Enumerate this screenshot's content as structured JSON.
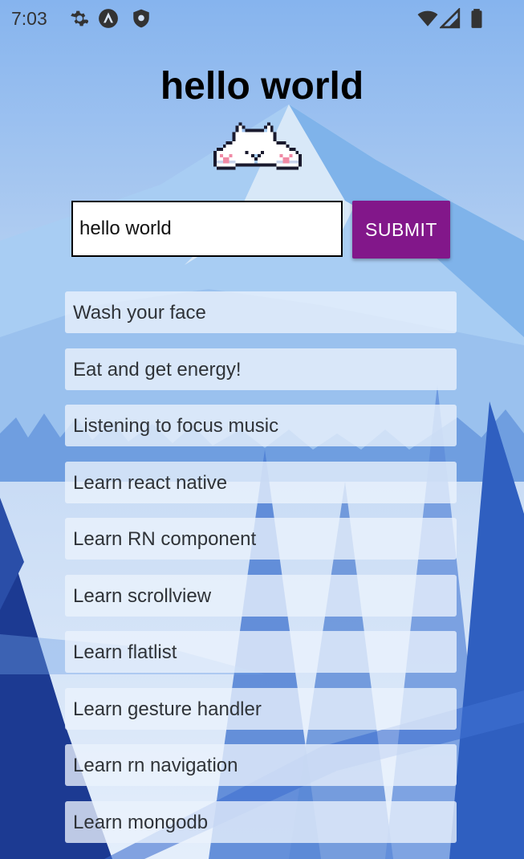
{
  "status_bar": {
    "time": "7:03",
    "icons": [
      "gear-icon",
      "a-logo-icon",
      "shield-icon",
      "wifi-icon",
      "signal-icon",
      "battery-icon"
    ]
  },
  "app": {
    "title": "hello world",
    "mascot": "pixel-cat-icon"
  },
  "form": {
    "input_value": "hello world",
    "submit_label": "SUBMIT"
  },
  "colors": {
    "accent": "#82178a",
    "background_sky": "#7fb0e9",
    "mountain": "#a6cdf2",
    "tree_dark": "#1e3f96"
  },
  "todos": [
    "Wash your face",
    "Eat and get energy!",
    "Listening to focus music",
    "Learn react native",
    "Learn RN component",
    "Learn scrollview",
    "Learn flatlist",
    "Learn gesture handler",
    "Learn rn navigation",
    "Learn mongodb"
  ]
}
